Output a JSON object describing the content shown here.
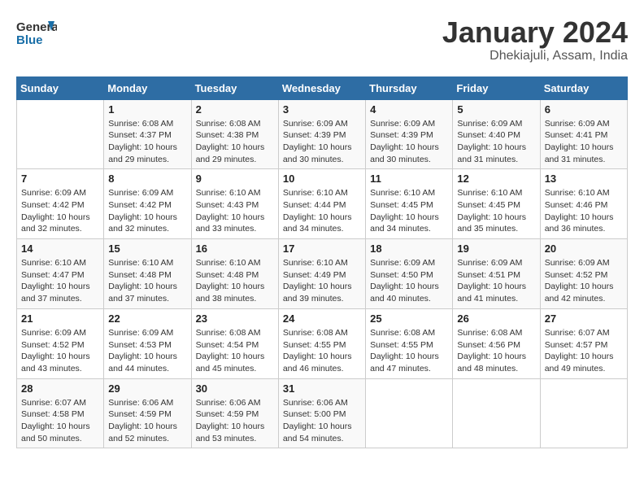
{
  "header": {
    "logo_general": "General",
    "logo_blue": "Blue",
    "month": "January 2024",
    "location": "Dhekiajuli, Assam, India"
  },
  "weekdays": [
    "Sunday",
    "Monday",
    "Tuesday",
    "Wednesday",
    "Thursday",
    "Friday",
    "Saturday"
  ],
  "weeks": [
    [
      {
        "date": "",
        "info": ""
      },
      {
        "date": "1",
        "info": "Sunrise: 6:08 AM\nSunset: 4:37 PM\nDaylight: 10 hours\nand 29 minutes."
      },
      {
        "date": "2",
        "info": "Sunrise: 6:08 AM\nSunset: 4:38 PM\nDaylight: 10 hours\nand 29 minutes."
      },
      {
        "date": "3",
        "info": "Sunrise: 6:09 AM\nSunset: 4:39 PM\nDaylight: 10 hours\nand 30 minutes."
      },
      {
        "date": "4",
        "info": "Sunrise: 6:09 AM\nSunset: 4:39 PM\nDaylight: 10 hours\nand 30 minutes."
      },
      {
        "date": "5",
        "info": "Sunrise: 6:09 AM\nSunset: 4:40 PM\nDaylight: 10 hours\nand 31 minutes."
      },
      {
        "date": "6",
        "info": "Sunrise: 6:09 AM\nSunset: 4:41 PM\nDaylight: 10 hours\nand 31 minutes."
      }
    ],
    [
      {
        "date": "7",
        "info": "Sunrise: 6:09 AM\nSunset: 4:42 PM\nDaylight: 10 hours\nand 32 minutes."
      },
      {
        "date": "8",
        "info": "Sunrise: 6:09 AM\nSunset: 4:42 PM\nDaylight: 10 hours\nand 32 minutes."
      },
      {
        "date": "9",
        "info": "Sunrise: 6:10 AM\nSunset: 4:43 PM\nDaylight: 10 hours\nand 33 minutes."
      },
      {
        "date": "10",
        "info": "Sunrise: 6:10 AM\nSunset: 4:44 PM\nDaylight: 10 hours\nand 34 minutes."
      },
      {
        "date": "11",
        "info": "Sunrise: 6:10 AM\nSunset: 4:45 PM\nDaylight: 10 hours\nand 34 minutes."
      },
      {
        "date": "12",
        "info": "Sunrise: 6:10 AM\nSunset: 4:45 PM\nDaylight: 10 hours\nand 35 minutes."
      },
      {
        "date": "13",
        "info": "Sunrise: 6:10 AM\nSunset: 4:46 PM\nDaylight: 10 hours\nand 36 minutes."
      }
    ],
    [
      {
        "date": "14",
        "info": "Sunrise: 6:10 AM\nSunset: 4:47 PM\nDaylight: 10 hours\nand 37 minutes."
      },
      {
        "date": "15",
        "info": "Sunrise: 6:10 AM\nSunset: 4:48 PM\nDaylight: 10 hours\nand 37 minutes."
      },
      {
        "date": "16",
        "info": "Sunrise: 6:10 AM\nSunset: 4:48 PM\nDaylight: 10 hours\nand 38 minutes."
      },
      {
        "date": "17",
        "info": "Sunrise: 6:10 AM\nSunset: 4:49 PM\nDaylight: 10 hours\nand 39 minutes."
      },
      {
        "date": "18",
        "info": "Sunrise: 6:09 AM\nSunset: 4:50 PM\nDaylight: 10 hours\nand 40 minutes."
      },
      {
        "date": "19",
        "info": "Sunrise: 6:09 AM\nSunset: 4:51 PM\nDaylight: 10 hours\nand 41 minutes."
      },
      {
        "date": "20",
        "info": "Sunrise: 6:09 AM\nSunset: 4:52 PM\nDaylight: 10 hours\nand 42 minutes."
      }
    ],
    [
      {
        "date": "21",
        "info": "Sunrise: 6:09 AM\nSunset: 4:52 PM\nDaylight: 10 hours\nand 43 minutes."
      },
      {
        "date": "22",
        "info": "Sunrise: 6:09 AM\nSunset: 4:53 PM\nDaylight: 10 hours\nand 44 minutes."
      },
      {
        "date": "23",
        "info": "Sunrise: 6:08 AM\nSunset: 4:54 PM\nDaylight: 10 hours\nand 45 minutes."
      },
      {
        "date": "24",
        "info": "Sunrise: 6:08 AM\nSunset: 4:55 PM\nDaylight: 10 hours\nand 46 minutes."
      },
      {
        "date": "25",
        "info": "Sunrise: 6:08 AM\nSunset: 4:55 PM\nDaylight: 10 hours\nand 47 minutes."
      },
      {
        "date": "26",
        "info": "Sunrise: 6:08 AM\nSunset: 4:56 PM\nDaylight: 10 hours\nand 48 minutes."
      },
      {
        "date": "27",
        "info": "Sunrise: 6:07 AM\nSunset: 4:57 PM\nDaylight: 10 hours\nand 49 minutes."
      }
    ],
    [
      {
        "date": "28",
        "info": "Sunrise: 6:07 AM\nSunset: 4:58 PM\nDaylight: 10 hours\nand 50 minutes."
      },
      {
        "date": "29",
        "info": "Sunrise: 6:06 AM\nSunset: 4:59 PM\nDaylight: 10 hours\nand 52 minutes."
      },
      {
        "date": "30",
        "info": "Sunrise: 6:06 AM\nSunset: 4:59 PM\nDaylight: 10 hours\nand 53 minutes."
      },
      {
        "date": "31",
        "info": "Sunrise: 6:06 AM\nSunset: 5:00 PM\nDaylight: 10 hours\nand 54 minutes."
      },
      {
        "date": "",
        "info": ""
      },
      {
        "date": "",
        "info": ""
      },
      {
        "date": "",
        "info": ""
      }
    ]
  ]
}
